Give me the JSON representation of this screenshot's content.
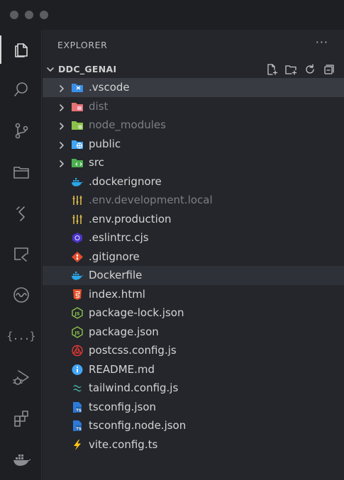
{
  "explorer": {
    "title": "EXPLORER",
    "more": "···",
    "root": "DDC_GENAI"
  },
  "tree": [
    {
      "name": ".vscode",
      "icon": "vscode-folder-icon",
      "folder": true,
      "color": "#3a8ee6"
    },
    {
      "name": "dist",
      "icon": "dist-folder-icon",
      "folder": true,
      "color": "#e57373",
      "dim": true
    },
    {
      "name": "node_modules",
      "icon": "node-modules-folder-icon",
      "folder": true,
      "color": "#8bc34a",
      "dim": true
    },
    {
      "name": "public",
      "icon": "public-folder-icon",
      "folder": true,
      "color": "#42a5f5"
    },
    {
      "name": "src",
      "icon": "src-folder-icon",
      "folder": true,
      "color": "#4caf50"
    },
    {
      "name": ".dockerignore",
      "icon": "docker-icon"
    },
    {
      "name": ".env.development.local",
      "icon": "env-icon",
      "dim": true
    },
    {
      "name": ".env.production",
      "icon": "env-icon"
    },
    {
      "name": ".eslintrc.cjs",
      "icon": "eslint-icon"
    },
    {
      "name": ".gitignore",
      "icon": "git-icon"
    },
    {
      "name": "Dockerfile",
      "icon": "docker-icon"
    },
    {
      "name": "index.html",
      "icon": "html-icon"
    },
    {
      "name": "package-lock.json",
      "icon": "nodejs-icon"
    },
    {
      "name": "package.json",
      "icon": "nodejs-icon"
    },
    {
      "name": "postcss.config.js",
      "icon": "postcss-icon"
    },
    {
      "name": "README.md",
      "icon": "info-icon"
    },
    {
      "name": "tailwind.config.js",
      "icon": "tailwind-icon"
    },
    {
      "name": "tsconfig.json",
      "icon": "tsconfig-icon"
    },
    {
      "name": "tsconfig.node.json",
      "icon": "tsconfig-icon"
    },
    {
      "name": "vite.config.ts",
      "icon": "vite-icon"
    }
  ],
  "state": {
    "selected": ".vscode",
    "highlighted": "Dockerfile"
  },
  "colors": {
    "sidebar": "#24262b",
    "activitybar": "#1e1f22",
    "selection": "#383b42"
  }
}
